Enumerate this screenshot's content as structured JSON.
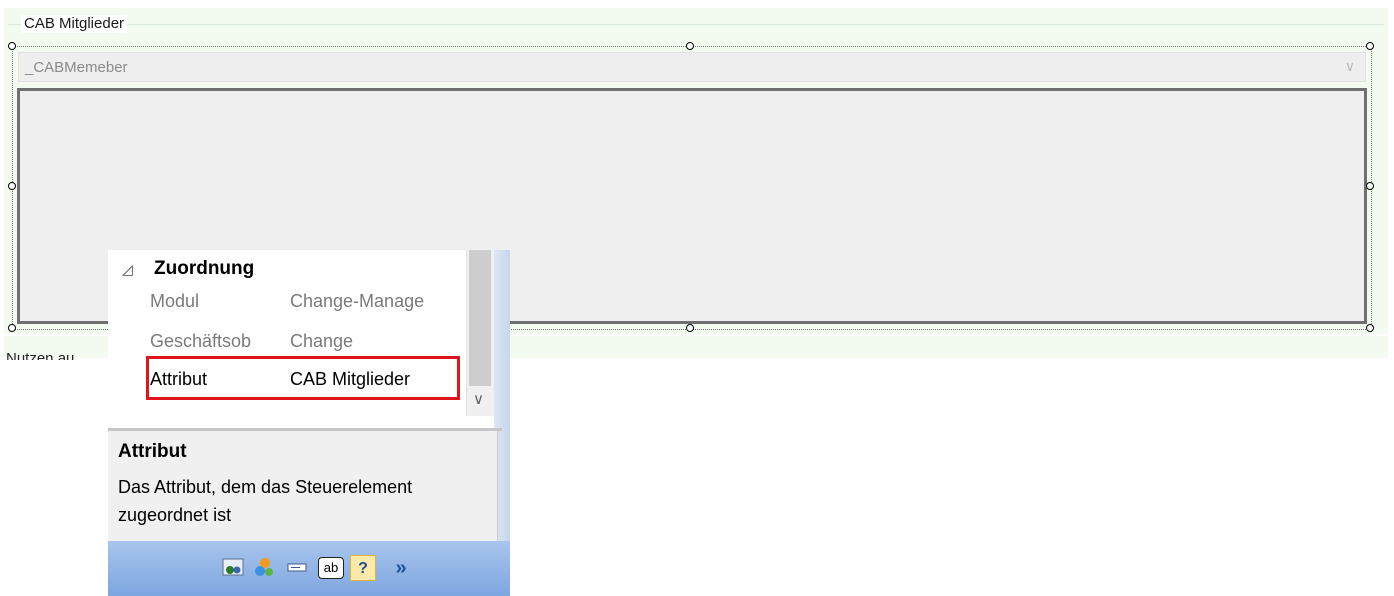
{
  "group": {
    "title": "CAB Mitglieder",
    "combo_value": "_CABMemeber",
    "truncated_label": "Nutzen au"
  },
  "properties": {
    "category": "Zuordnung",
    "rows": [
      {
        "name": "Modul",
        "value": "Change-Manage"
      },
      {
        "name": "Geschäftsob",
        "value": "Change"
      },
      {
        "name": "Attribut",
        "value": "CAB Mitglieder"
      }
    ]
  },
  "description": {
    "title": "Attribut",
    "text": "Das Attribut, dem das Steuerelement zugeordnet ist"
  },
  "icons": {
    "collapse": "◿",
    "dropdown": "∨",
    "toolbar": [
      "user-group-icon",
      "shapes-icon",
      "text-field-icon",
      "ab-icon",
      "help-form-icon",
      "expand-icon"
    ]
  },
  "toolbar_labels": {
    "ab": "ab",
    "help": "?",
    "more": "»"
  },
  "colors": {
    "highlight": "#e0141a",
    "toolbar": "#8fb3e6"
  }
}
